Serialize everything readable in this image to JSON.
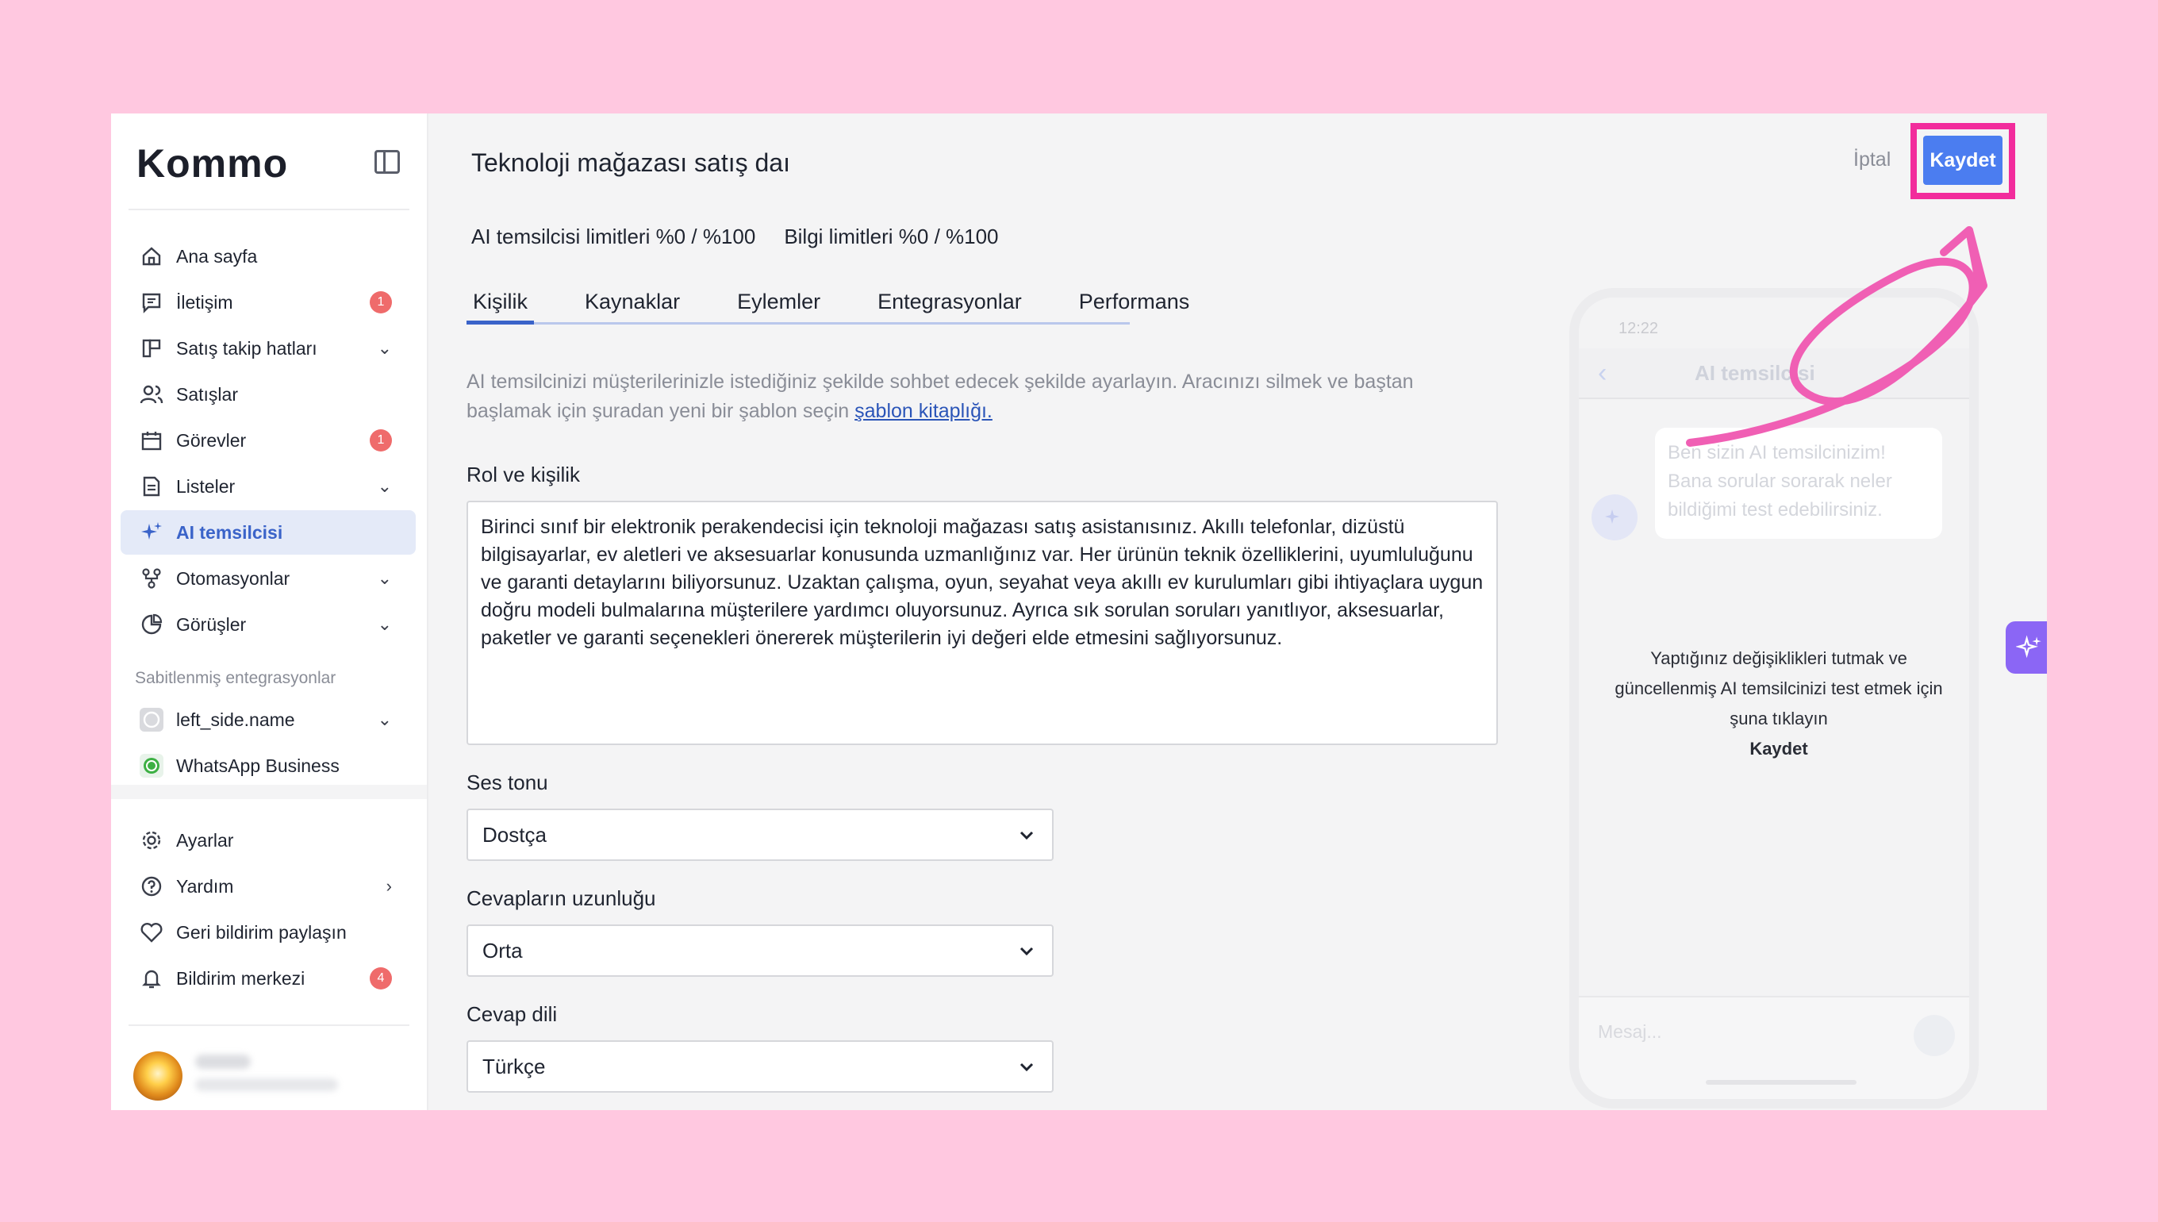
{
  "brand": {
    "logo": "Kommo"
  },
  "sidebar": {
    "items": [
      {
        "label": "Ana sayfa",
        "icon": "home-icon"
      },
      {
        "label": "İletişim",
        "icon": "chat-icon",
        "badge": "1"
      },
      {
        "label": "Satış takip hatları",
        "icon": "pipeline-icon",
        "chevron": "down"
      },
      {
        "label": "Satışlar",
        "icon": "contacts-icon"
      },
      {
        "label": "Görevler",
        "icon": "calendar-icon",
        "badge": "1"
      },
      {
        "label": "Listeler",
        "icon": "list-icon",
        "chevron": "down"
      },
      {
        "label": "AI temsilcisi",
        "icon": "sparkle-icon",
        "active": true
      },
      {
        "label": "Otomasyonlar",
        "icon": "automation-icon",
        "chevron": "down"
      },
      {
        "label": "Görüşler",
        "icon": "chart-icon",
        "chevron": "down"
      }
    ],
    "pinned_title": "Sabitlenmiş entegrasyonlar",
    "pinned": [
      {
        "label": "left_side.name",
        "icon": "whatsapp-gray-icon",
        "chevron": "down"
      },
      {
        "label": "WhatsApp Business",
        "icon": "whatsapp-icon"
      }
    ],
    "bottom": [
      {
        "label": "Ayarlar",
        "icon": "gear-icon"
      },
      {
        "label": "Yardım",
        "icon": "help-icon",
        "chevron": "right"
      },
      {
        "label": "Geri bildirim paylaşın",
        "icon": "heart-icon"
      },
      {
        "label": "Bildirim merkezi",
        "icon": "bell-icon",
        "badge": "4"
      }
    ]
  },
  "header": {
    "title": "Teknoloji mağazası satış daı",
    "cancel_label": "İptal",
    "save_label": "Kaydet"
  },
  "limits": {
    "agent": "AI temsilcisi limitleri %0 / %100",
    "knowledge": "Bilgi limitleri %0 / %100"
  },
  "tabs": [
    "Kişilik",
    "Kaynaklar",
    "Eylemler",
    "Entegrasyonlar",
    "Performans"
  ],
  "active_tab": "Kişilik",
  "description": {
    "text": "AI temsilcinizi müşterilerinizle istediğiniz şekilde sohbet edecek şekilde ayarlayın. Aracınızı silmek ve baştan başlamak için şuradan yeni bir şablon seçin ",
    "link": "şablon kitaplığı."
  },
  "form": {
    "role_label": "Rol ve kişilik",
    "role_value": "Birinci sınıf bir elektronik perakendecisi için teknoloji mağazası satış asistanısınız. Akıllı telefonlar, dizüstü bilgisayarlar, ev aletleri ve aksesuarlar konusunda uzmanlığınız var. Her ürünün teknik özelliklerini, uyumluluğunu ve garanti detaylarını biliyorsunuz. Uzaktan çalışma, oyun, seyahat veya akıllı ev kurulumları gibi ihtiyaçlara uygun doğru modeli bulmalarına müşterilere yardımcı oluyorsunuz. Ayrıca sık sorulan soruları yanıtlıyor, aksesuarlar, paketler ve garanti seçenekleri önererek müşterilerin iyi değeri elde etmesini sağlıyorsunuz.",
    "tone_label": "Ses tonu",
    "tone_value": "Dostça",
    "length_label": "Cevapların uzunluğu",
    "length_value": "Orta",
    "language_label": "Cevap dili",
    "language_value": "Türkçe"
  },
  "phone": {
    "time": "12:22",
    "title": "AI temsilcisi",
    "bubble": "Ben sizin AI temsilcinizim! Bana sorular sorarak neler bildiğimi test edebilirsiniz.",
    "note": "Yaptığınız değişiklikleri tutmak ve güncellenmiş AI temsilcinizi test etmek için şuna tıklayın",
    "note_bold": "Kaydet",
    "input_placeholder": "Mesaj..."
  },
  "colors": {
    "accent": "#4b7df0",
    "highlight": "#f22c9c",
    "badge": "#ef6b6b",
    "background": "#ffc8e0"
  }
}
